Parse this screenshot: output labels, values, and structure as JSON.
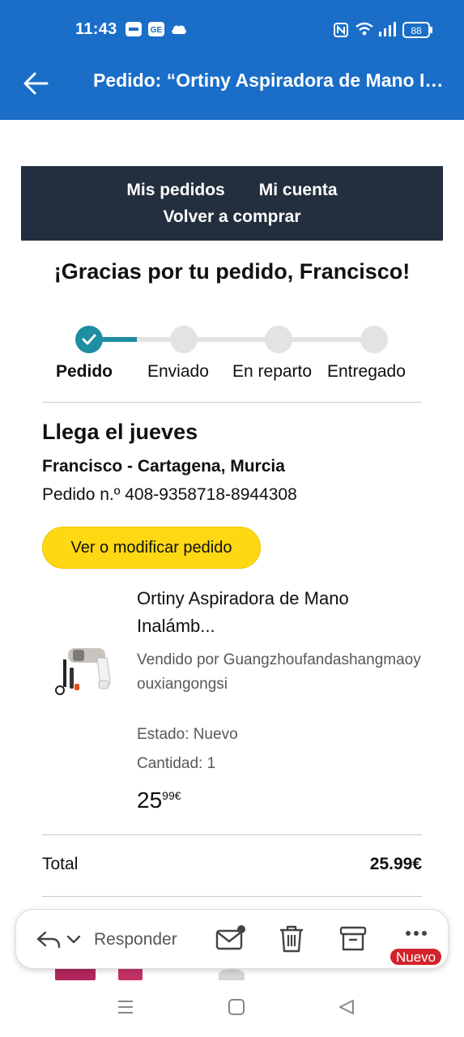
{
  "status_bar": {
    "time": "11:43",
    "battery": "88",
    "icons": [
      "news-app-icon",
      "ge-app-icon",
      "cloud-icon",
      "nfc-icon",
      "wifi-icon",
      "signal-icon",
      "battery-icon"
    ]
  },
  "app_bar": {
    "back_icon": "arrow-left-icon",
    "title": "Pedido: “Ortiny Aspiradora de Mano Inalámb...”"
  },
  "email": {
    "nav": {
      "my_orders": "Mis pedidos",
      "my_account": "Mi cuenta",
      "buy_again": "Volver a comprar"
    },
    "thanks": "¡Gracias por tu pedido, Francisco!",
    "progress": {
      "current_step": 1,
      "steps": [
        "Pedido",
        "Enviado",
        "En reparto",
        "Entregado"
      ]
    },
    "arrival": "Llega el jueves",
    "address": "Francisco - Cartagena, Murcia",
    "order_number": "Pedido n.º 408-9358718-8944308",
    "view_button": "Ver o modificar pedido",
    "product": {
      "title": "Ortiny Aspiradora de Mano Inalámb...",
      "sold_by": "Vendido por Guangzhoufandashangmaoyouxiangongsi",
      "condition": "Estado: Nuevo",
      "quantity": "Cantidad: 1",
      "price_whole": "25",
      "price_fraction": "99€"
    },
    "total_label": "Total",
    "total_value": "25.99€"
  },
  "toolbar": {
    "reply_label": "Responder",
    "icons": [
      "reply-icon",
      "chevron-down-icon",
      "mark-unread-icon",
      "trash-icon",
      "archive-icon",
      "more-icon"
    ],
    "badge": "Nuevo"
  },
  "colors": {
    "app_bar": "#1a6ec8",
    "nav_box": "#232f3e",
    "progress_done": "#1f8ea1",
    "button_yellow": "#ffd814",
    "badge_red": "#d2232a"
  }
}
